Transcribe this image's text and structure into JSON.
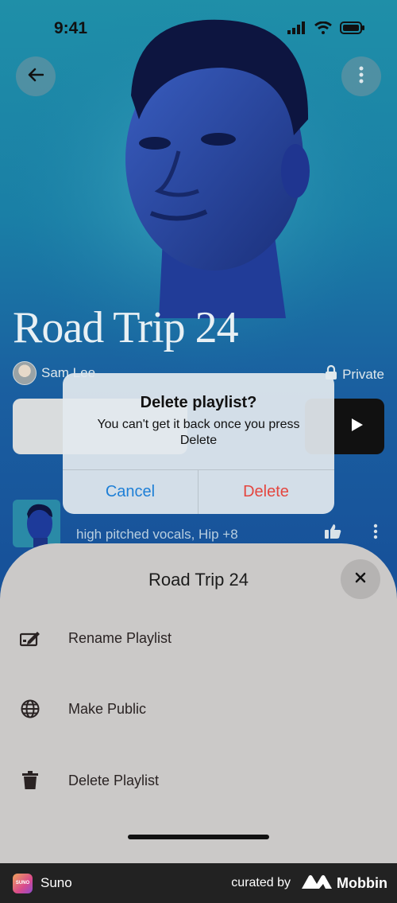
{
  "status_bar": {
    "time": "9:41"
  },
  "playlist": {
    "title": "Road Trip 24",
    "owner": "Sam Lee",
    "privacy": "Private"
  },
  "song": {
    "tags": "high pitched vocals, Hip +8"
  },
  "alert": {
    "title": "Delete playlist?",
    "message": "You can't get it back once you press Delete",
    "cancel_label": "Cancel",
    "delete_label": "Delete"
  },
  "sheet": {
    "title": "Road Trip 24",
    "items": [
      {
        "label": "Rename Playlist",
        "icon": "rename-icon"
      },
      {
        "label": "Make Public",
        "icon": "globe-icon"
      },
      {
        "label": "Delete Playlist",
        "icon": "trash-icon"
      }
    ]
  },
  "footer": {
    "app_name": "Suno",
    "app_icon_text": "SUNO",
    "curated_by": "curated by",
    "brand": "Mobbin"
  },
  "colors": {
    "accent_blue": "#1e7fd6",
    "destructive_red": "#e4463f",
    "sheet_bg": "#cbc9c8"
  }
}
